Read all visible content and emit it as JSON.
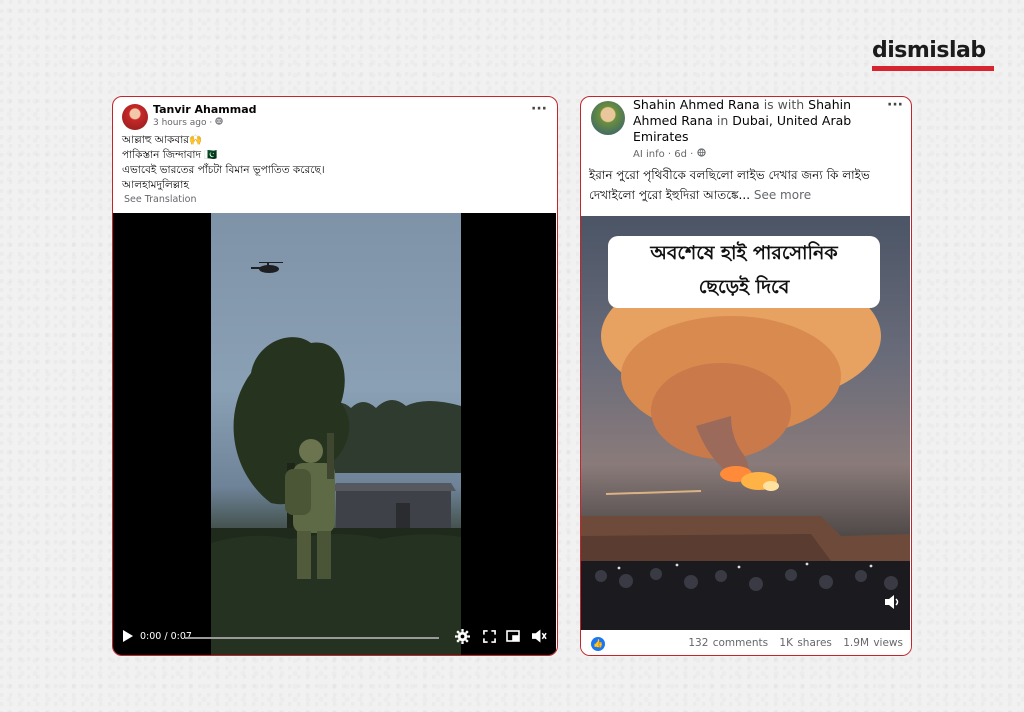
{
  "brand": {
    "logo_text": "dismislab",
    "accent": "#d8242f"
  },
  "left_post": {
    "author": "Tanvir Ahammad",
    "time": "3 hours ago",
    "privacy_icon": "globe-icon",
    "lines": [
      "আল্লাহু আকবার🙌",
      "পাকিস্তান জিন্দাবাদ 🇵🇰",
      "এভাবেই ভারতের পাঁচটা বিমান ভূপাতিত করেছে।",
      "আলহামদুলিল্লাহ"
    ],
    "see_translation": "See Translation",
    "video": {
      "time": "0:00 / 0:07",
      "progress": 0.0,
      "icons": [
        "play-icon",
        "settings-icon",
        "fullscreen-icon",
        "pip-icon",
        "mute-icon"
      ]
    }
  },
  "right_post": {
    "author": "Shahin Ahmed Rana",
    "with_word": "is with",
    "with_name": "Shahin Ahmed Rana",
    "in_word": "in",
    "location": "Dubai, United Arab Emirates",
    "meta": "AI info · 6d ·",
    "text": "ইরান পুরো পৃথিবীকে বলছিলো লাইভ দেখার জন্য কি লাইভ দেখাইলো পুরো ইহুদিরা আতঙ্কে...",
    "see_more": "See more",
    "image_caption_line1": "অবশেষে হাই পারসোনিক",
    "image_caption_line2": "ছেড়েই দিবে",
    "stats": {
      "comments": "132 comments",
      "shares": "1K shares",
      "views": "1.9M views"
    }
  }
}
